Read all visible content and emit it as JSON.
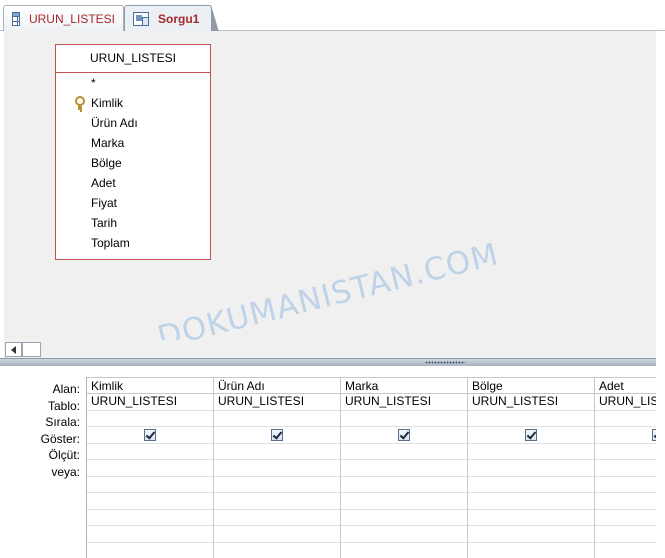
{
  "tabs": [
    {
      "label": "URUN_LISTESI",
      "icon": "table-icon",
      "active": false
    },
    {
      "label": "Sorgu1",
      "icon": "query-icon",
      "active": true
    }
  ],
  "table_box": {
    "title": "URUN_LISTESI",
    "fields": [
      {
        "label": "*",
        "key": false
      },
      {
        "label": "Kimlik",
        "key": true
      },
      {
        "label": "Ürün Adı",
        "key": false
      },
      {
        "label": "Marka",
        "key": false
      },
      {
        "label": "Bölge",
        "key": false
      },
      {
        "label": "Adet",
        "key": false
      },
      {
        "label": "Fiyat",
        "key": false
      },
      {
        "label": "Tarih",
        "key": false
      },
      {
        "label": "Toplam",
        "key": false
      }
    ]
  },
  "watermark": "DOKUMANISTAN.COM",
  "qbe": {
    "row_labels": [
      "Alan:",
      "Tablo:",
      "Sırala:",
      "Göster:",
      "Ölçüt:",
      "veya:"
    ],
    "columns": [
      {
        "field": "Kimlik",
        "table": "URUN_LISTESI",
        "show": true
      },
      {
        "field": "Ürün Adı",
        "table": "URUN_LISTESI",
        "show": true
      },
      {
        "field": "Marka",
        "table": "URUN_LISTESI",
        "show": true
      },
      {
        "field": "Bölge",
        "table": "URUN_LISTESI",
        "show": true
      },
      {
        "field": "Adet",
        "table": "URUN_LISTESI",
        "show": true
      }
    ]
  },
  "colors": {
    "tab_text": "#a52a2a",
    "table_border": "#c0504d",
    "design_bg": "#f0f0f0",
    "watermark": "#96b9e1"
  }
}
